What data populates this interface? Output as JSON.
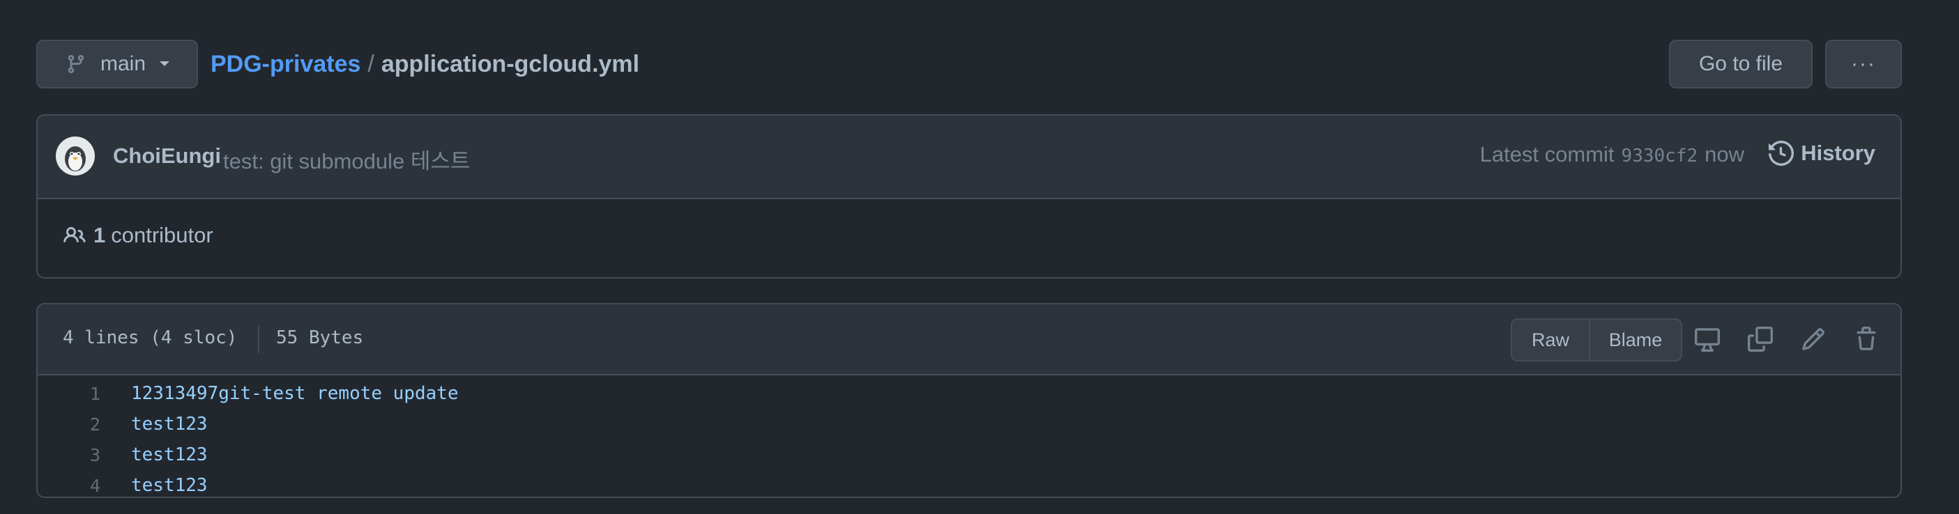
{
  "branch": {
    "name": "main"
  },
  "breadcrumb": {
    "repo": "PDG-privates",
    "separator": "/",
    "file": "application-gcloud.yml"
  },
  "actions": {
    "go_to_file": "Go to file",
    "more": "···"
  },
  "commit": {
    "author": "ChoiEungi",
    "message": "test: git submodule 테스트",
    "latest_label": "Latest commit",
    "sha": "9330cf2",
    "time": "now",
    "history_label": "History"
  },
  "contributors": {
    "count": "1",
    "label": "contributor"
  },
  "file": {
    "lines_info": "4 lines (4 sloc)",
    "size": "55 Bytes",
    "raw_label": "Raw",
    "blame_label": "Blame",
    "lines": [
      {
        "num": "1",
        "text": "12313497git-test remote update"
      },
      {
        "num": "2",
        "text": "test123"
      },
      {
        "num": "3",
        "text": "test123"
      },
      {
        "num": "4",
        "text": "test123"
      }
    ]
  },
  "colors": {
    "link": "#539bf5",
    "background": "#22272e",
    "header": "#2d333b",
    "border": "#444c56"
  },
  "icons": [
    "git-branch-icon",
    "caret-down-icon",
    "history-icon",
    "people-icon",
    "desktop-icon",
    "copy-icon",
    "pencil-icon",
    "trash-icon"
  ]
}
